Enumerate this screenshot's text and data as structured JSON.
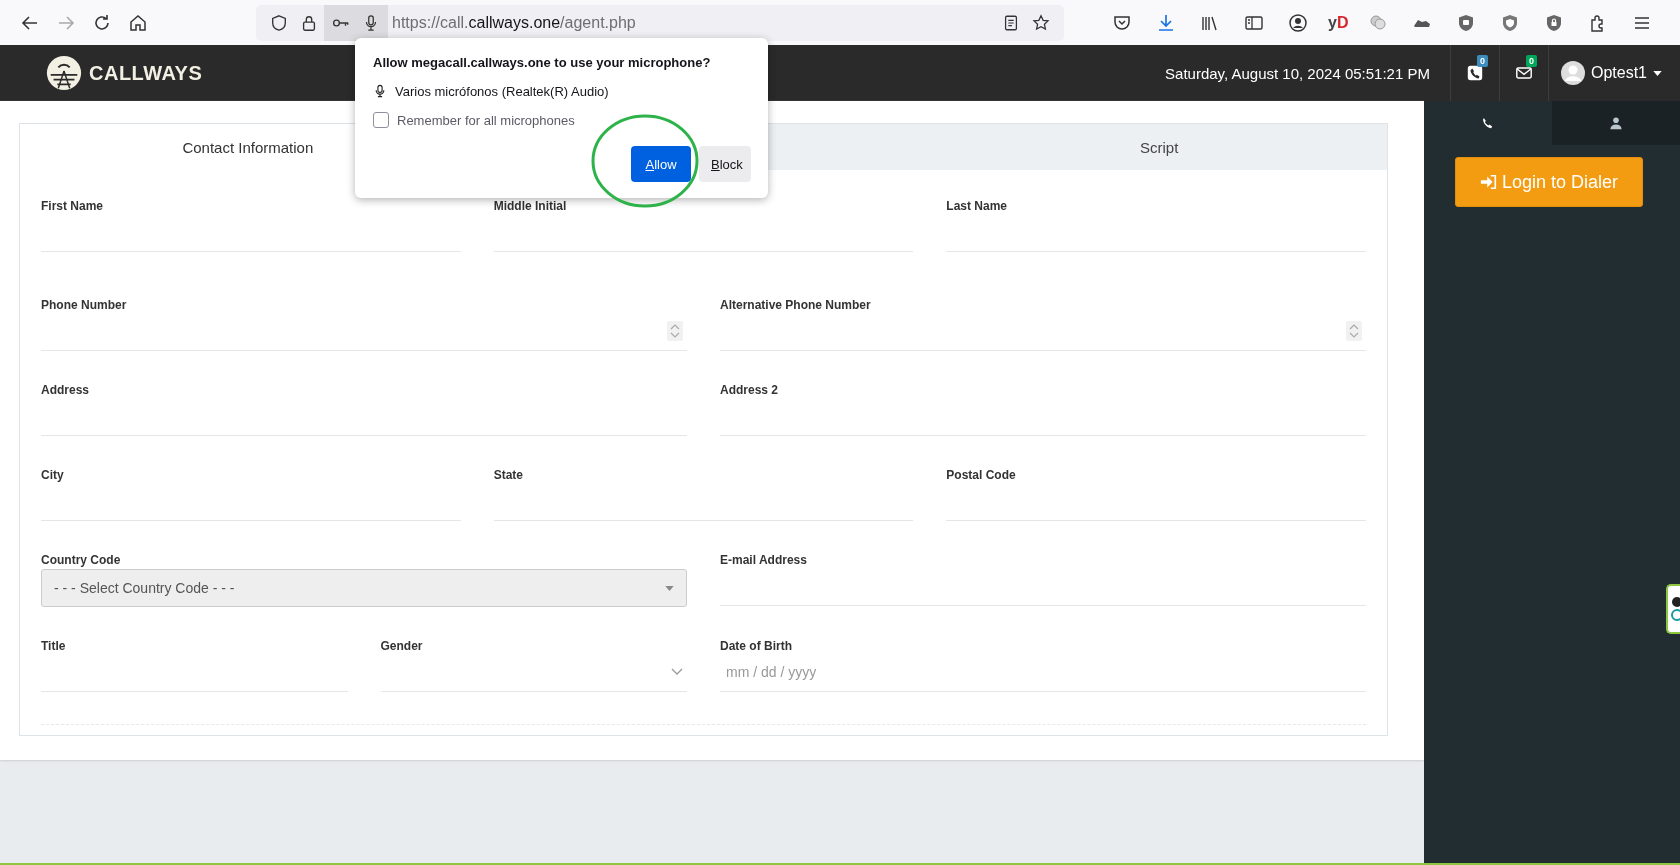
{
  "browser": {
    "back_disabled": false,
    "forward_disabled": true,
    "url": {
      "prefix": "https://call.",
      "domain": "callways.one",
      "path": "/agent.php"
    },
    "extension_label": "yD"
  },
  "header": {
    "brand": "CALLWAYS",
    "datetime": "Saturday, August 10, 2024 05:51:21 PM",
    "badges": [
      {
        "kind": "phone",
        "count": "0",
        "color": "#3c8dbc"
      },
      {
        "kind": "mail",
        "count": "0",
        "color": "#00a65a"
      }
    ],
    "user": "Optest1"
  },
  "tabs": [
    {
      "label": "Contact Information",
      "selected": true
    },
    {
      "selected": false
    },
    {
      "label": "Script",
      "selected": false
    }
  ],
  "form_rows": [
    [
      {
        "label": "First Name",
        "kind": "text"
      },
      {
        "label": "Middle Initial",
        "kind": "text"
      },
      {
        "label": "Last Name",
        "kind": "text"
      }
    ],
    [
      {
        "label": "Phone Number",
        "kind": "number"
      },
      {
        "label": "Alternative Phone Number",
        "kind": "number"
      }
    ],
    [
      {
        "label": "Address",
        "kind": "text"
      },
      {
        "label": "Address 2",
        "kind": "text"
      }
    ],
    [
      {
        "label": "City",
        "kind": "text"
      },
      {
        "label": "State",
        "kind": "text"
      },
      {
        "label": "Postal Code",
        "kind": "text"
      }
    ],
    [
      {
        "label": "Country Code",
        "kind": "select",
        "value": "- - - Select Country Code - - -"
      },
      {
        "label": "E-mail Address",
        "kind": "text"
      }
    ],
    [
      {
        "label": "Title",
        "kind": "text"
      },
      {
        "label": "Gender",
        "kind": "dropdown"
      },
      {
        "label": "Date of Birth",
        "kind": "date",
        "placeholder": "mm / dd / yyyy"
      }
    ]
  ],
  "side_panel": {
    "tabs": [
      {
        "kind": "phone",
        "selected": true
      },
      {
        "kind": "user",
        "selected": false
      }
    ],
    "login_button": "Login to Dialer"
  },
  "permission_popup": {
    "question": "Allow megacall.callways.one to use your microphone?",
    "device": "Varios micrófonos (Realtek(R) Audio)",
    "remember": {
      "label": "Remember for all microphones",
      "checked": false
    },
    "allow": "Allow",
    "block": "Block",
    "highlighted": true
  }
}
